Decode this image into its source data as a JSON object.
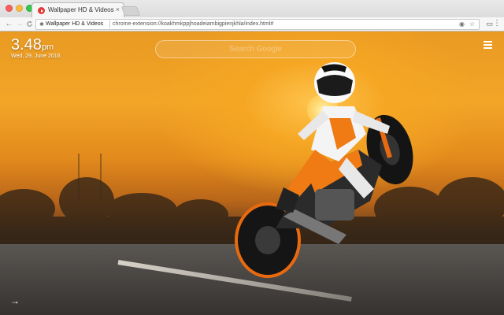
{
  "browser": {
    "tab": {
      "title": "Wallpaper HD & Videos",
      "close": "×",
      "favicon_color": "#e53935"
    },
    "toolbar": {
      "back": "←",
      "forward": "→",
      "reload": "C",
      "site_label": "Wallpaper HD & Videos",
      "url": "chrome-extension://koakhmkppjhoadeiambigpienjkhla/index.html#",
      "menu": "⋮"
    }
  },
  "page": {
    "time": "3.48",
    "time_suffix": "pm",
    "date": "Wed, 29. June 2016",
    "search": {
      "placeholder": "Search Google",
      "value": ""
    },
    "next_arrow": "→"
  },
  "colors": {
    "sky_top": "#e99a22",
    "sun_glow": "#ffc44d",
    "bike_orange": "#f07a14",
    "road": "#4a4643"
  }
}
